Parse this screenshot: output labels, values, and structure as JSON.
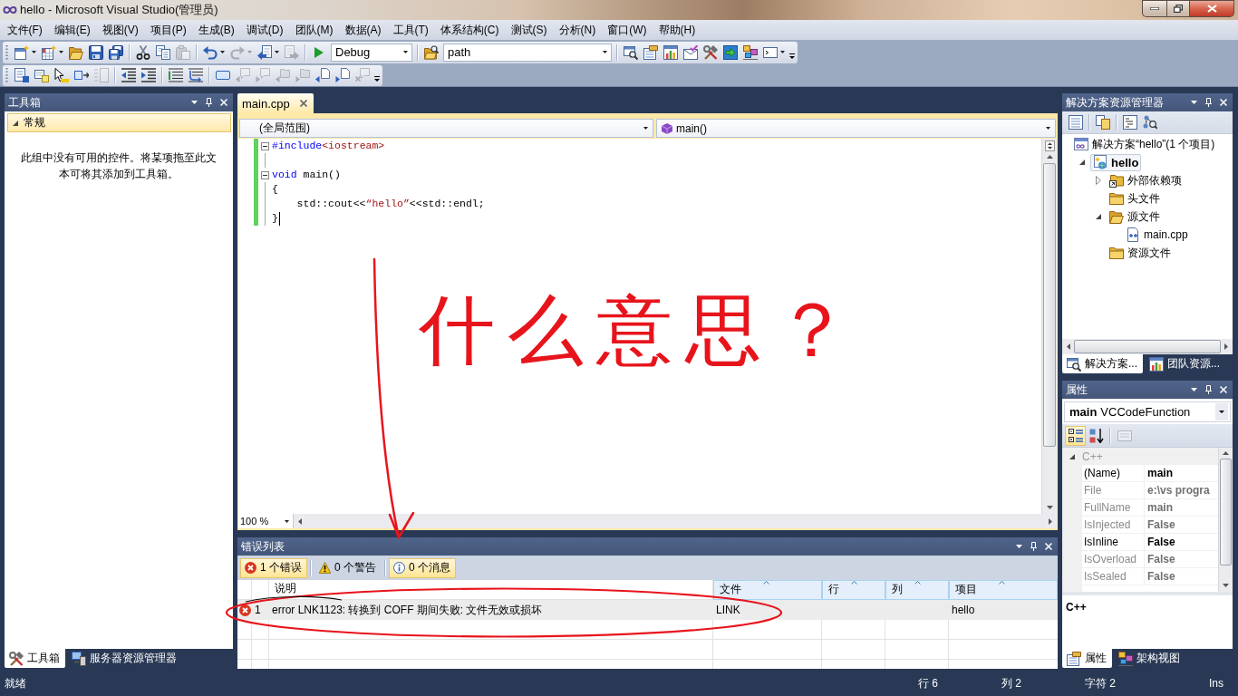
{
  "window": {
    "title": "hello - Microsoft Visual Studio(管理员)"
  },
  "menu": [
    "文件(F)",
    "编辑(E)",
    "视图(V)",
    "项目(P)",
    "生成(B)",
    "调试(D)",
    "团队(M)",
    "数据(A)",
    "工具(T)",
    "体系结构(C)",
    "测试(S)",
    "分析(N)",
    "窗口(W)",
    "帮助(H)"
  ],
  "toolbars": [
    [
      {
        "kind": "new-project",
        "dropdown": true,
        "disabled": false
      },
      {
        "kind": "add-item",
        "dropdown": true,
        "disabled": false
      },
      {
        "kind": "open",
        "disabled": false
      },
      {
        "kind": "save",
        "disabled": false
      },
      {
        "kind": "save-all",
        "disabled": false
      },
      {
        "kind": "separator"
      },
      {
        "kind": "cut",
        "disabled": false
      },
      {
        "kind": "copy",
        "disabled": false
      },
      {
        "kind": "paste",
        "disabled": true
      },
      {
        "kind": "separator"
      },
      {
        "kind": "undo",
        "dropdown": true,
        "disabled": false
      },
      {
        "kind": "redo",
        "dropdown": true,
        "disabled": true
      },
      {
        "kind": "navigate-back",
        "dropdown": true,
        "disabled": false
      },
      {
        "kind": "navigate-forward",
        "disabled": true
      },
      {
        "kind": "separator"
      },
      {
        "kind": "start",
        "disabled": false
      },
      {
        "kind": "combo",
        "value": "Debug"
      },
      {
        "kind": "separator"
      },
      {
        "kind": "find-in-files",
        "disabled": false
      },
      {
        "kind": "combo",
        "value": "path"
      },
      {
        "kind": "separator"
      },
      {
        "kind": "find",
        "disabled": false
      },
      {
        "kind": "properties",
        "disabled": false
      },
      {
        "kind": "object-browser",
        "disabled": false
      },
      {
        "kind": "extension",
        "disabled": false
      },
      {
        "kind": "toolbox",
        "disabled": false
      },
      {
        "kind": "start-page",
        "disabled": false
      },
      {
        "kind": "class-view",
        "disabled": false
      },
      {
        "kind": "command-window",
        "dropdown": true,
        "disabled": false
      },
      {
        "kind": "overflow"
      }
    ],
    [
      {
        "kind": "list-members",
        "disabled": false
      },
      {
        "kind": "parameter-info",
        "disabled": false
      },
      {
        "kind": "quick-info",
        "disabled": false
      },
      {
        "kind": "complete-word",
        "disabled": false
      },
      {
        "kind": "outline",
        "disabled": true
      },
      {
        "kind": "separator"
      },
      {
        "kind": "outdent",
        "disabled": false
      },
      {
        "kind": "indent",
        "disabled": false
      },
      {
        "kind": "separator"
      },
      {
        "kind": "comment",
        "disabled": false
      },
      {
        "kind": "uncomment",
        "disabled": false
      },
      {
        "kind": "separator"
      },
      {
        "kind": "bookmark",
        "disabled": false
      },
      {
        "kind": "bookmark-prev",
        "disabled": true
      },
      {
        "kind": "bookmark-next",
        "disabled": true
      },
      {
        "kind": "folder-prev",
        "disabled": true
      },
      {
        "kind": "folder-next",
        "disabled": true
      },
      {
        "kind": "page-prev",
        "disabled": false
      },
      {
        "kind": "page-next",
        "disabled": false
      },
      {
        "kind": "clear-bookmarks",
        "disabled": true
      },
      {
        "kind": "overflow"
      }
    ]
  ],
  "toolbox": {
    "title": "工具箱",
    "groups": [
      {
        "label": "常规",
        "expanded": true
      }
    ],
    "message": "此组中没有可用的控件。将某项拖至此文本可将其添加到工具箱。",
    "tabs": [
      {
        "kind": "toolbox",
        "label": "工具箱",
        "selected": true
      },
      {
        "kind": "server-explorer",
        "label": "服务器资源管理器",
        "selected": false
      }
    ]
  },
  "editor": {
    "tabs": [
      {
        "label": "main.cpp",
        "selected": true
      }
    ],
    "scope": "(全局范围)",
    "member": "main()",
    "lines": [
      {
        "changed": true,
        "expanded": true,
        "caret": false,
        "tokens": [
          {
            "kind": "keyword",
            "text": "#include"
          },
          {
            "kind": "string",
            "text": "<iostream>"
          }
        ]
      },
      {
        "changed": true,
        "caret": false
      },
      {
        "changed": true,
        "expanded": true,
        "caret": false,
        "tokens": [
          {
            "kind": "keyword",
            "text": "void"
          },
          {
            "kind": "text",
            "text": " main()"
          }
        ]
      },
      {
        "changed": true,
        "caret": false,
        "tokens": [
          {
            "kind": "text",
            "text": "{"
          }
        ]
      },
      {
        "changed": true,
        "caret": false,
        "tokens": [
          {
            "kind": "text",
            "text": "    std::cout<<"
          },
          {
            "kind": "string",
            "text": "“hello”"
          },
          {
            "kind": "text",
            "text": "<<std::endl;"
          }
        ]
      },
      {
        "changed": true,
        "caret": true,
        "tokens": [
          {
            "kind": "text",
            "text": "}"
          }
        ]
      }
    ],
    "zoom": "100 %"
  },
  "error_list": {
    "title": "错误列表",
    "filters": [
      {
        "kind": "error",
        "label": "1 个错误",
        "selected": true
      },
      {
        "kind": "warning",
        "label": "0 个警告",
        "selected": false
      },
      {
        "kind": "message",
        "label": "0 个消息",
        "selected": true
      }
    ],
    "columns": [
      {
        "label": "说明",
        "sort_arrow": false
      },
      {
        "label": "文件",
        "sort_arrow": true
      },
      {
        "label": "行",
        "sort_arrow": true
      },
      {
        "label": "列",
        "sort_arrow": true
      },
      {
        "label": "项目",
        "sort_arrow": true
      }
    ],
    "rows": [
      {
        "kind": "error",
        "selected": true,
        "number": "1",
        "description": "error LNK1123: 转换到 COFF 期间失败: 文件无效或损坏",
        "file": "LINK",
        "project": "hello"
      }
    ]
  },
  "solution_explorer": {
    "title": "解决方案资源管理器",
    "tree": [
      {
        "kind": "solution",
        "label": "解决方案“hello”(1 个项目)",
        "selected": false,
        "children": [
          {
            "kind": "project",
            "label": "hello",
            "selected": true,
            "expanded": true,
            "children": [
              {
                "kind": "references",
                "label": "外部依赖项",
                "selected": false,
                "expanded": false
              },
              {
                "kind": "folder",
                "label": "头文件",
                "selected": false
              },
              {
                "kind": "folder",
                "label": "源文件",
                "selected": false,
                "expanded": true,
                "children": [
                  {
                    "kind": "file",
                    "label": "main.cpp",
                    "selected": false
                  }
                ]
              },
              {
                "kind": "folder",
                "label": "资源文件",
                "selected": false
              }
            ]
          }
        ]
      }
    ],
    "tabs": [
      {
        "kind": "solution-explorer",
        "label": "解决方案...",
        "selected": true
      },
      {
        "kind": "team-explorer",
        "label": "团队资源...",
        "selected": false
      }
    ]
  },
  "properties": {
    "title": "属性",
    "object": {
      "name": "main",
      "type": "VCCodeFunction"
    },
    "toolbar": [
      {
        "kind": "categorized",
        "selected": true,
        "disabled": false
      },
      {
        "kind": "alphabetical",
        "selected": false,
        "disabled": false
      },
      {
        "kind": "separator"
      },
      {
        "kind": "property-pages",
        "selected": false,
        "disabled": true
      }
    ],
    "categories": [
      {
        "label": "C++",
        "expanded": true,
        "rows": [
          {
            "name": "(Name)",
            "value": "main",
            "readonly": false
          },
          {
            "name": "File",
            "value": "e:\\vs progra",
            "readonly": true
          },
          {
            "name": "FullName",
            "value": "main",
            "readonly": true
          },
          {
            "name": "IsInjected",
            "value": "False",
            "readonly": true
          },
          {
            "name": "IsInline",
            "value": "False",
            "readonly": false
          },
          {
            "name": "IsOverload",
            "value": "False",
            "readonly": true
          },
          {
            "name": "IsSealed",
            "value": "False",
            "readonly": true
          }
        ]
      }
    ],
    "description": {
      "title": "C++"
    },
    "tabs": [
      {
        "kind": "properties",
        "label": "属性",
        "selected": true
      },
      {
        "kind": "architecture-explorer",
        "label": "架构视图",
        "selected": false
      }
    ]
  },
  "status_bar": {
    "message": "就绪",
    "fields": [
      "行 6",
      "列 2",
      "字符 2",
      "Ins"
    ]
  },
  "annotation": {
    "text": "什么意思？"
  }
}
